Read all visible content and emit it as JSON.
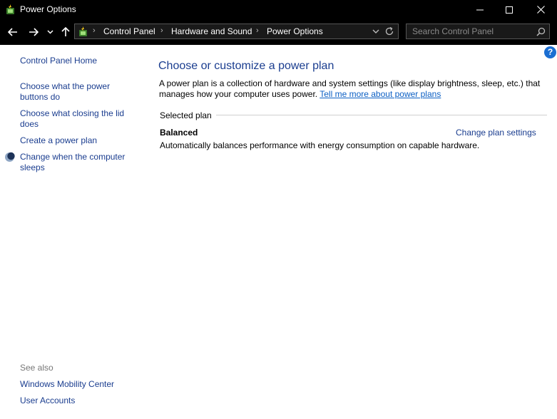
{
  "window": {
    "title": "Power Options"
  },
  "breadcrumb": {
    "items": [
      "Control Panel",
      "Hardware and Sound",
      "Power Options"
    ]
  },
  "search": {
    "placeholder": "Search Control Panel"
  },
  "sidebar": {
    "home_label": "Control Panel Home",
    "links": [
      "Choose what the power buttons do",
      "Choose what closing the lid does",
      "Create a power plan",
      "Change when the computer sleeps"
    ],
    "see_also_label": "See also",
    "see_also_links": [
      "Windows Mobility Center",
      "User Accounts"
    ]
  },
  "main": {
    "title": "Choose or customize a power plan",
    "intro_text": "A power plan is a collection of hardware and system settings (like display brightness, sleep, etc.) that manages how your computer uses power. ",
    "intro_link": "Tell me more about power plans",
    "selected_plan_label": "Selected plan",
    "plan": {
      "name": "Balanced",
      "description": "Automatically balances performance with energy consumption on capable hardware.",
      "settings_link": "Change plan settings"
    },
    "help_glyph": "?"
  },
  "colors": {
    "link": "#1a3d8f",
    "hyperlink": "#0b5fc4",
    "titlebar": "#000000",
    "help_icon": "#1b6ed2"
  },
  "icons": {
    "app": "power-options-icon",
    "minimize": "minimize-icon",
    "maximize": "maximize-icon",
    "close": "close-icon",
    "back": "back-arrow-icon",
    "forward": "forward-arrow-icon",
    "recent": "chevron-down-icon",
    "up": "up-arrow-icon",
    "address_dropdown": "chevron-down-icon",
    "refresh": "refresh-icon",
    "search": "search-icon",
    "help": "help-icon",
    "sleep": "moon-icon"
  }
}
